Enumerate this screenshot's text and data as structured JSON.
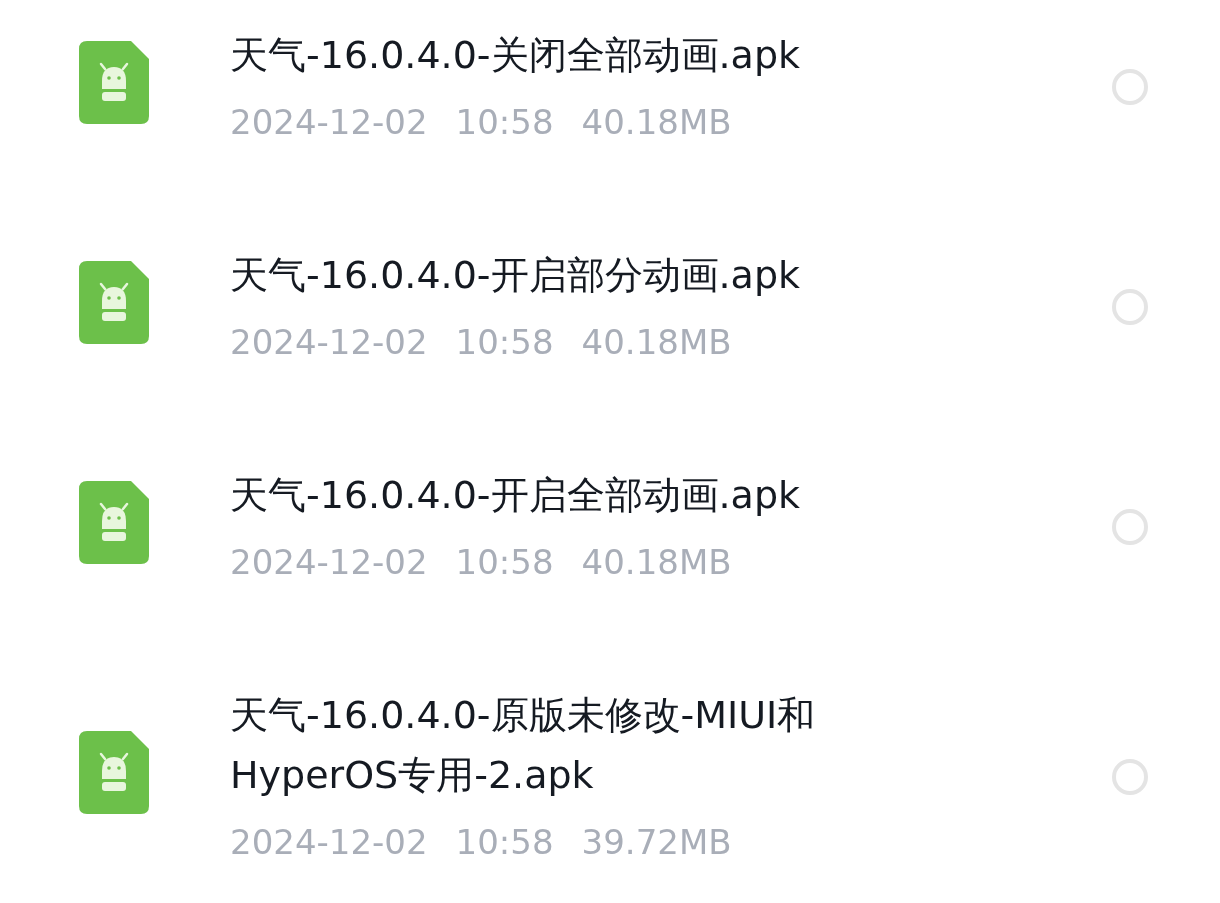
{
  "files": [
    {
      "name": "天气-16.0.4.0-关闭全部动画.apk",
      "date": "2024-12-02",
      "time": "10:58",
      "size": "40.18MB",
      "selected": false
    },
    {
      "name": "天气-16.0.4.0-开启部分动画.apk",
      "date": "2024-12-02",
      "time": "10:58",
      "size": "40.18MB",
      "selected": false
    },
    {
      "name": "天气-16.0.4.0-开启全部动画.apk",
      "date": "2024-12-02",
      "time": "10:58",
      "size": "40.18MB",
      "selected": false
    },
    {
      "name": "天气-16.0.4.0-原版未修改-MIUI和HyperOS专用-2.apk",
      "date": "2024-12-02",
      "time": "10:58",
      "size": "39.72MB",
      "selected": false
    }
  ]
}
